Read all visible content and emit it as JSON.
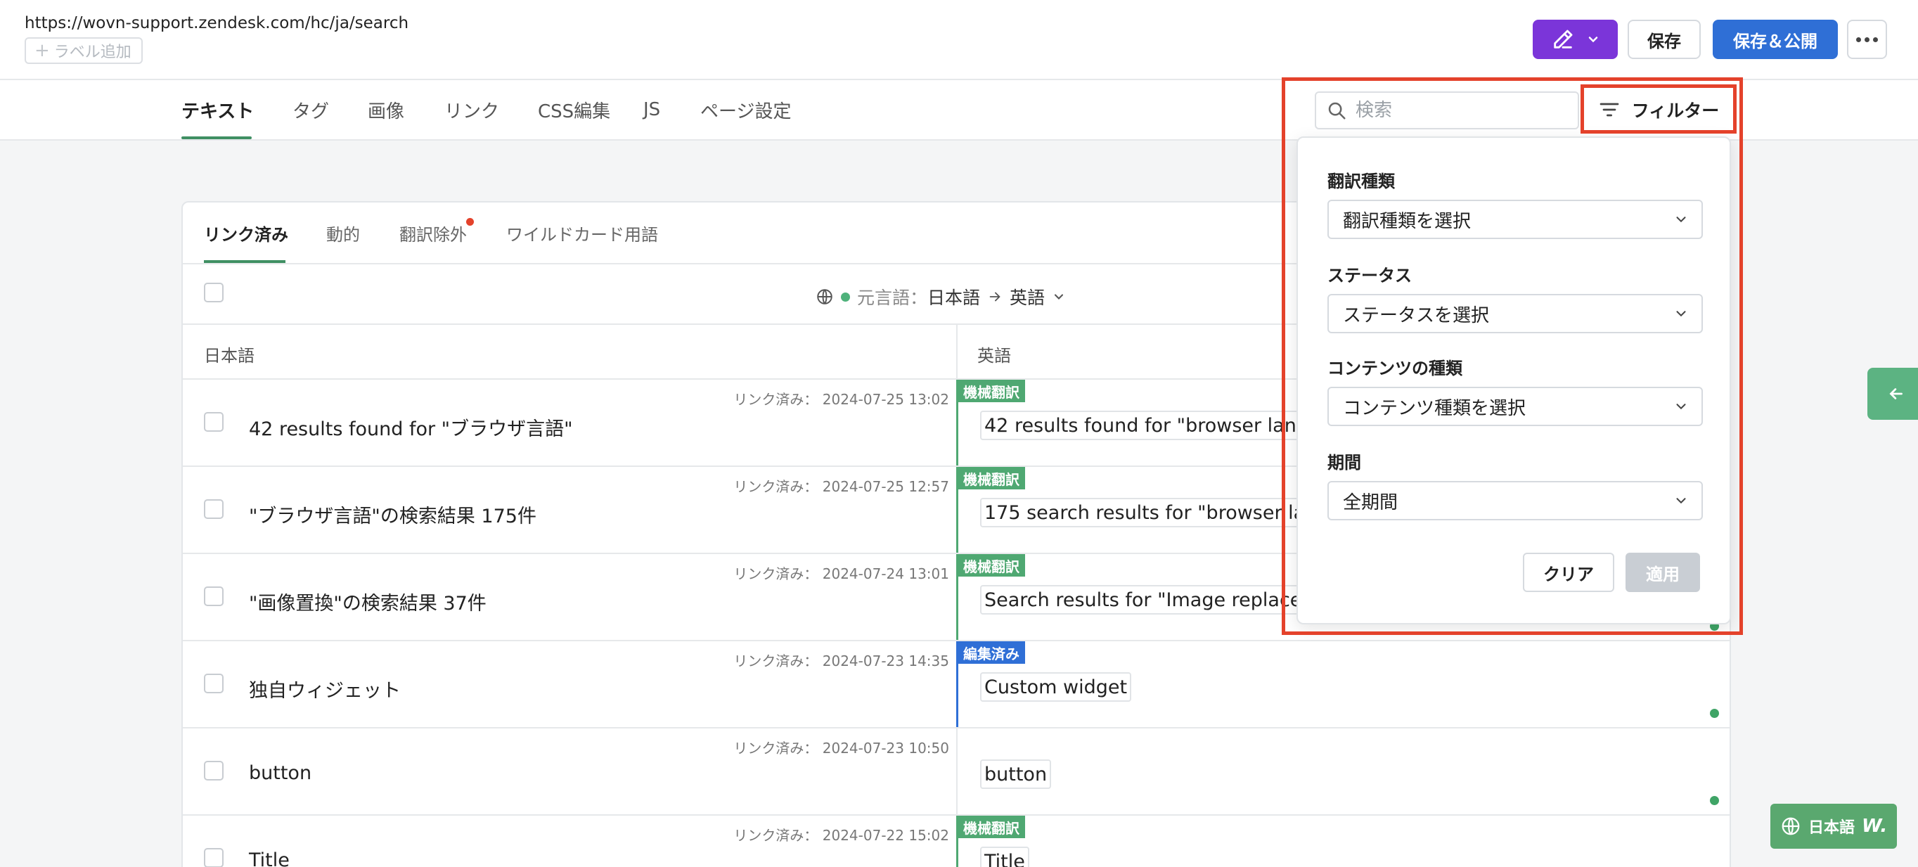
{
  "topbar": {
    "url": "https://wovn-support.zendesk.com/hc/ja/search",
    "add_label": "ラベル追加",
    "save_label": "保存",
    "publish_label": "保存＆公開"
  },
  "nav": {
    "tabs": [
      "テキスト",
      "タグ",
      "画像",
      "リンク",
      "CSS編集",
      "JS",
      "ページ設定"
    ],
    "search_placeholder": "検索",
    "filter_label": "フィルター"
  },
  "panel": {
    "subtabs": [
      "リンク済み",
      "動的",
      "翻訳除外",
      "ワイルドカード用語"
    ],
    "language": {
      "source_prefix": "元言語：",
      "source": "日本語",
      "target": "英語"
    },
    "columns": [
      "日本語",
      "英語"
    ],
    "rows": [
      {
        "meta": "リンク済み： 2024-07-25 13:02",
        "source": "42 results found for \"ブラウザ言語\"",
        "badge": "機械翻訳",
        "badge_type": "mt",
        "target": "42 results found for \"browser languag"
      },
      {
        "meta": "リンク済み： 2024-07-25 12:57",
        "source": "\"ブラウザ言語\"の検索結果 175件",
        "badge": "機械翻訳",
        "badge_type": "mt",
        "target": "175 search results for \"browser langua"
      },
      {
        "meta": "リンク済み： 2024-07-24 13:01",
        "source": "\"画像置換\"の検索結果 37件",
        "badge": "機械翻訳",
        "badge_type": "mt",
        "target": "Search results for \"Image replacemen"
      },
      {
        "meta": "リンク済み： 2024-07-23 14:35",
        "source": "独自ウィジェット",
        "badge": "編集済み",
        "badge_type": "ed",
        "target": "Custom widget"
      },
      {
        "meta": "リンク済み： 2024-07-23 10:50",
        "source": "button",
        "badge": "",
        "badge_type": "",
        "target": "button"
      },
      {
        "meta": "リンク済み： 2024-07-22 15:02",
        "source": "Title",
        "badge": "機械翻訳",
        "badge_type": "mt",
        "target": "Title"
      }
    ]
  },
  "filter_panel": {
    "translation_type_label": "翻訳種類",
    "translation_type_value": "翻訳種類を選択",
    "status_label": "ステータス",
    "status_value": "ステータスを選択",
    "content_type_label": "コンテンツの種類",
    "content_type_value": "コンテンツ種類を選択",
    "period_label": "期間",
    "period_value": "全期間",
    "clear_label": "クリア",
    "apply_label": "適用"
  },
  "lang_widget": {
    "label": "日本語",
    "logo": "W."
  },
  "colors": {
    "accent_green": "#3f8f63",
    "primary_blue": "#2f6fd6",
    "purple": "#7b35d9",
    "highlight_red": "#e4422b",
    "machine_badge": "#4fa872",
    "edited_badge": "#2f6fd6"
  }
}
